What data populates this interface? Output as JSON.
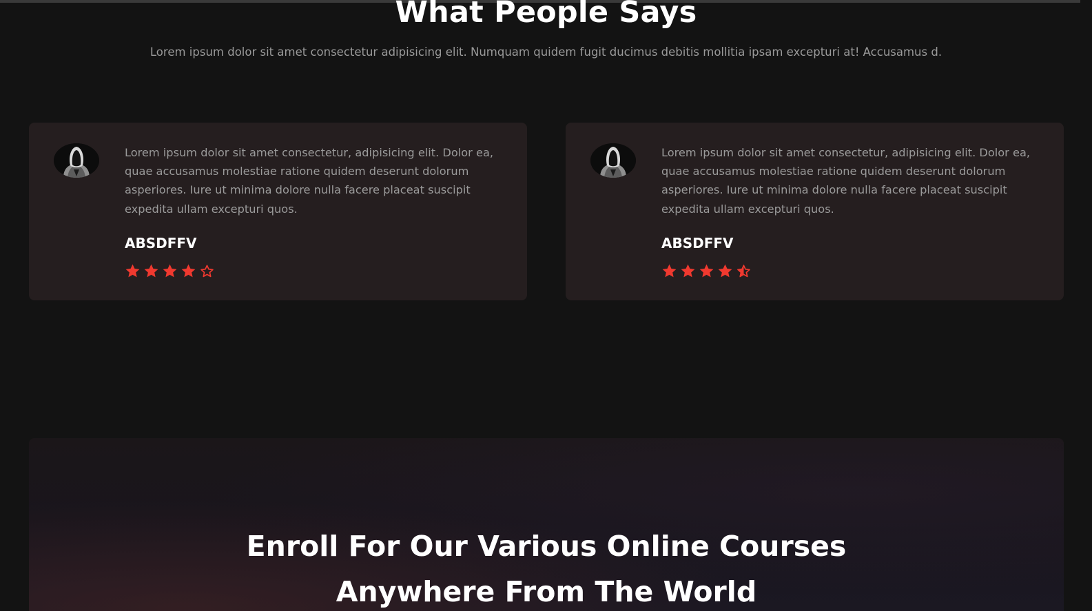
{
  "testimonials_section": {
    "title": "What People Says",
    "subtitle": "Lorem ipsum dolor sit amet consectetur adipisicing elit. Numquam quidem fugit ducimus debitis mollitia ipsam excepturi at! Accusamus d."
  },
  "testimonials": [
    {
      "quote": "Lorem ipsum dolor sit amet consectetur, adipisicing elit. Dolor ea, quae accusamus molestiae ratione quidem deserunt dolorum asperiores. Iure ut minima dolore nulla facere placeat suscipit expedita ullam excepturi quos.",
      "name": "ABSDFFV",
      "rating": 4,
      "avatar_icon": "hooded-person-avatar"
    },
    {
      "quote": "Lorem ipsum dolor sit amet consectetur, adipisicing elit. Dolor ea, quae accusamus molestiae ratione quidem deserunt dolorum asperiores. Iure ut minima dolore nulla facere placeat suscipit expedita ullam excepturi quos.",
      "name": "ABSDFFV",
      "rating": 4.5,
      "avatar_icon": "hooded-person-avatar"
    }
  ],
  "enroll_banner": {
    "title_line1": "Enroll For Our Various Online Courses",
    "title_line2": "Anywhere From The World"
  },
  "colors": {
    "background": "#131313",
    "card": "#251e1f",
    "star": "#f0392f",
    "heading": "#ffffff",
    "body_text": "#9a9a9a"
  },
  "icons": {
    "star_full": "star-icon",
    "star_half": "star-half-icon",
    "star_empty": "star-outline-icon"
  }
}
